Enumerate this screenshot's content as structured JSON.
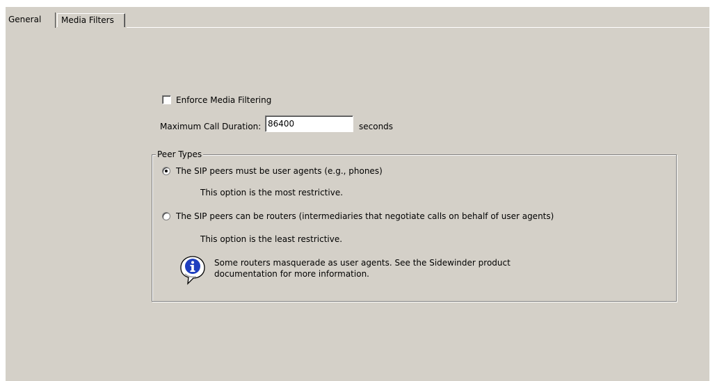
{
  "tabs": {
    "general": "General",
    "media_filters": "Media Filters"
  },
  "general": {
    "enforce_media_filtering": {
      "label": "Enforce Media Filtering",
      "checked": false
    },
    "max_call_duration": {
      "label": "Maximum Call Duration:",
      "value": "86400",
      "unit": "seconds"
    },
    "peer_types": {
      "legend": "Peer Types",
      "options": [
        {
          "label": "The SIP peers must be user agents (e.g., phones)",
          "note": "This option is the most restrictive.",
          "selected": true
        },
        {
          "label": "The SIP peers can be routers (intermediaries that negotiate calls on behalf of user agents)",
          "note": "This option is the least restrictive.",
          "selected": false
        }
      ],
      "info": {
        "icon": "info-icon",
        "line1": "Some routers masquerade as user agents. See the Sidewinder product",
        "line2": "documentation for more information."
      }
    }
  },
  "colors": {
    "panel": "#d4d0c8",
    "info_blue": "#1f3fbf"
  }
}
